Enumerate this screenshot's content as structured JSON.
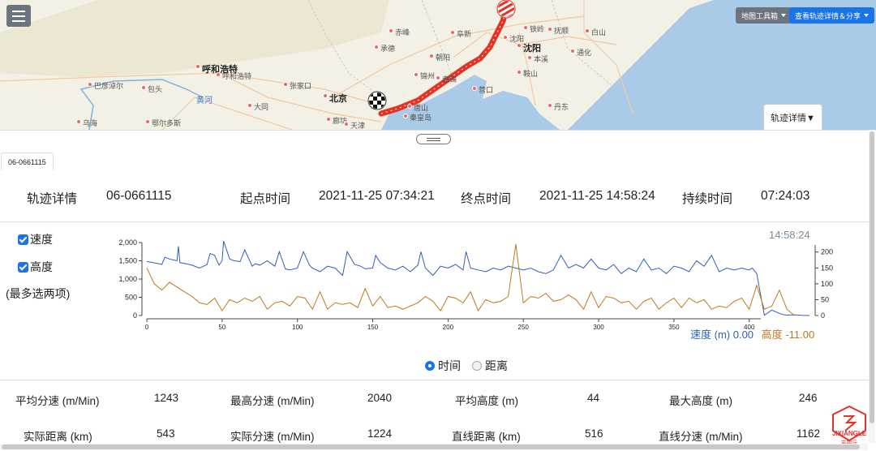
{
  "map": {
    "labels": [
      {
        "text": "赤峰",
        "cls": ""
      },
      {
        "text": "阜新",
        "cls": ""
      },
      {
        "text": "铁岭",
        "cls": ""
      },
      {
        "text": "沈阳",
        "cls": ""
      },
      {
        "text": "沈阳",
        "cls": "big"
      },
      {
        "text": "抚顺",
        "cls": ""
      },
      {
        "text": "本溪",
        "cls": ""
      },
      {
        "text": "白山",
        "cls": ""
      },
      {
        "text": "通化",
        "cls": ""
      },
      {
        "text": "朝阳",
        "cls": ""
      },
      {
        "text": "锦州",
        "cls": ""
      },
      {
        "text": "盘锦",
        "cls": ""
      },
      {
        "text": "鞍山",
        "cls": ""
      },
      {
        "text": "营口",
        "cls": ""
      },
      {
        "text": "丹东",
        "cls": ""
      },
      {
        "text": "呼和浩特",
        "cls": "big"
      },
      {
        "text": "呼和浩特",
        "cls": ""
      },
      {
        "text": "巴彦淖尔",
        "cls": ""
      },
      {
        "text": "黄河",
        "cls": "water"
      },
      {
        "text": "包头",
        "cls": ""
      },
      {
        "text": "张家口",
        "cls": ""
      },
      {
        "text": "大同",
        "cls": ""
      },
      {
        "text": "北京",
        "cls": "big"
      },
      {
        "text": "廊坊",
        "cls": ""
      },
      {
        "text": "乌海",
        "cls": ""
      },
      {
        "text": "鄂尔多斯",
        "cls": ""
      },
      {
        "text": "天津",
        "cls": ""
      },
      {
        "text": "唐山",
        "cls": ""
      },
      {
        "text": "秦皇岛",
        "cls": ""
      },
      {
        "text": "承德",
        "cls": ""
      }
    ],
    "menu_icon": "hamburger-icon",
    "tools_button": "地图工具箱",
    "share_button": "查看轨迹详情＆分享",
    "detail_tab": "轨迹详情▼",
    "track_color": "#e53226",
    "start_marker": "checkered-flag-icon",
    "end_marker": "striped-flag-icon"
  },
  "panel": {
    "tab": "06-0661115",
    "info": {
      "title_label": "轨迹详情",
      "track_id": "06-0661115",
      "start_label": "起点时间",
      "start_time": "2021-11-25 07:34:21",
      "end_label": "终点时间",
      "end_time": "2021-11-25 14:58:24",
      "duration_label": "持续时间",
      "duration": "07:24:03"
    },
    "checkboxes": {
      "speed": "速度",
      "height": "高度",
      "max_two": "(最多选两项)"
    },
    "cursor_time": "14:58:24",
    "legend": {
      "speed_label": "速度 (m)",
      "speed_value": "0.00",
      "height_label": "高度",
      "height_value": "-11.00"
    },
    "radio": {
      "time": "时间",
      "distance": "距离",
      "selected": "time"
    },
    "stats": [
      [
        {
          "label": "平均分速 (m/Min)",
          "value": "1243"
        },
        {
          "label": "最高分速 (m/Min)",
          "value": "2040"
        },
        {
          "label": "平均高度 (m)",
          "value": "44"
        },
        {
          "label": "最大高度 (m)",
          "value": "246"
        }
      ],
      [
        {
          "label": "实际距离 (km)",
          "value": "543"
        },
        {
          "label": "实际分速 (m/Min)",
          "value": "1224"
        },
        {
          "label": "直线距离 (km)",
          "value": "516"
        },
        {
          "label": "直线分速 (m/Min)",
          "value": "1162"
        }
      ]
    ],
    "logo_text": "JIXIANGLE",
    "logo_sub": "吉翔乐"
  },
  "chart_data": {
    "type": "line",
    "x_ticks": [
      0,
      50,
      100,
      150,
      200,
      250,
      300,
      350,
      400
    ],
    "xlim": [
      0,
      440
    ],
    "y_left_ticks": [
      "0",
      "500",
      "1,000",
      "1,500",
      "2,000"
    ],
    "y_left_lim": [
      0,
      2000
    ],
    "y_right_ticks": [
      "0",
      "50",
      "100",
      "150",
      "200"
    ],
    "y_right_lim": [
      0,
      230
    ],
    "series": [
      {
        "name": "速度 (m)",
        "axis": "left",
        "color": "#2f5fb3",
        "x": [
          0,
          8,
          10,
          12,
          15,
          20,
          21,
          22,
          26,
          30,
          35,
          40,
          42,
          45,
          48,
          50,
          51,
          55,
          58,
          62,
          65,
          70,
          72,
          75,
          80,
          85,
          88,
          92,
          95,
          100,
          104,
          108,
          110,
          115,
          120,
          125,
          130,
          133,
          138,
          142,
          145,
          150,
          152,
          155,
          160,
          165,
          170,
          175,
          180,
          182,
          185,
          190,
          195,
          200,
          205,
          210,
          212,
          215,
          220,
          225,
          230,
          235,
          240,
          245,
          250,
          255,
          260,
          265,
          270,
          275,
          280,
          285,
          290,
          295,
          300,
          305,
          310,
          315,
          320,
          325,
          330,
          335,
          340,
          345,
          350,
          355,
          360,
          365,
          370,
          375,
          380,
          385,
          390,
          395,
          400,
          402,
          405,
          410,
          415,
          420,
          422,
          425,
          430,
          435,
          440
        ],
        "y": [
          1480,
          1420,
          1400,
          1600,
          1550,
          1500,
          1900,
          1450,
          1420,
          1380,
          1300,
          1400,
          1700,
          1650,
          1380,
          1500,
          2040,
          1550,
          1500,
          1480,
          1800,
          1350,
          1420,
          1380,
          1500,
          1350,
          1750,
          1280,
          1250,
          1300,
          1750,
          1380,
          1300,
          1200,
          1350,
          1300,
          1100,
          1750,
          1400,
          1350,
          1280,
          1300,
          1650,
          1450,
          1300,
          1250,
          1350,
          1200,
          1380,
          1750,
          1300,
          1100,
          1350,
          1300,
          1400,
          1250,
          1750,
          1300,
          1250,
          1200,
          1300,
          1250,
          1350,
          1300,
          1250,
          1300,
          1200,
          1150,
          1250,
          1650,
          1300,
          1400,
          1300,
          1550,
          1300,
          1250,
          1400,
          1150,
          1300,
          1200,
          1550,
          1250,
          1300,
          1150,
          1350,
          1300,
          1200,
          1500,
          1350,
          1650,
          1200,
          1300,
          1250,
          1300,
          1250,
          1300,
          1150,
          10,
          150,
          60,
          30,
          10,
          20,
          5,
          0
        ]
      },
      {
        "name": "高度",
        "axis": "right",
        "color": "#c0781e",
        "x": [
          0,
          5,
          10,
          15,
          20,
          25,
          30,
          35,
          40,
          45,
          50,
          55,
          60,
          65,
          70,
          75,
          80,
          85,
          90,
          95,
          100,
          105,
          110,
          115,
          120,
          125,
          130,
          135,
          140,
          145,
          150,
          155,
          160,
          165,
          170,
          175,
          180,
          185,
          190,
          195,
          200,
          205,
          210,
          215,
          220,
          225,
          230,
          235,
          240,
          245,
          250,
          255,
          260,
          265,
          270,
          275,
          280,
          285,
          290,
          295,
          300,
          305,
          310,
          315,
          320,
          325,
          330,
          335,
          340,
          345,
          350,
          355,
          360,
          365,
          370,
          375,
          380,
          385,
          390,
          395,
          400,
          405,
          410,
          415,
          420,
          425,
          430
        ],
        "y": [
          150,
          100,
          80,
          105,
          90,
          75,
          60,
          40,
          35,
          55,
          15,
          50,
          40,
          55,
          45,
          60,
          20,
          40,
          45,
          30,
          60,
          55,
          20,
          75,
          20,
          40,
          35,
          40,
          25,
          85,
          30,
          60,
          25,
          30,
          20,
          30,
          40,
          60,
          45,
          15,
          60,
          55,
          40,
          75,
          15,
          50,
          40,
          45,
          60,
          225,
          40,
          60,
          55,
          70,
          45,
          50,
          65,
          50,
          20,
          75,
          25,
          60,
          55,
          40,
          45,
          20,
          45,
          55,
          20,
          40,
          55,
          25,
          55,
          40,
          50,
          20,
          30,
          25,
          45,
          55,
          20,
          95,
          20,
          30,
          80,
          20,
          0
        ]
      }
    ]
  }
}
